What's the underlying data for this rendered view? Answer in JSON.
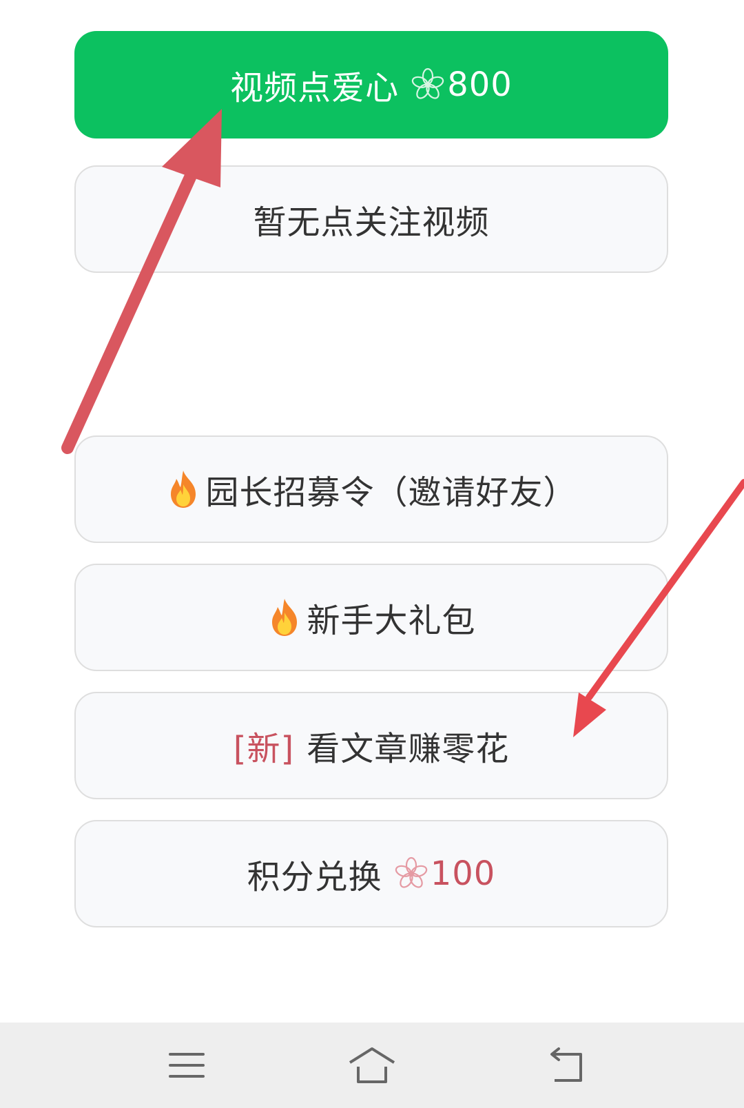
{
  "buttons": {
    "like_video": {
      "label": "视频点爱心",
      "points": "800"
    },
    "no_follow_video": {
      "label": "暂无点关注视频"
    },
    "invite": {
      "label": "园长招募令（邀请好友）"
    },
    "newbie_pack": {
      "label": "新手大礼包"
    },
    "read_articles": {
      "tag": "[新]",
      "label": "看文章赚零花"
    },
    "points_exchange": {
      "label": "积分兑换",
      "points": "100"
    }
  },
  "colors": {
    "primary_green": "#0cc160",
    "accent_red": "#c8525f",
    "annotation_arrow": "#d9575f"
  },
  "icons": {
    "points": "flower-icon",
    "hot": "fire-icon",
    "nav": [
      "menu-icon",
      "home-icon",
      "back-icon"
    ]
  }
}
